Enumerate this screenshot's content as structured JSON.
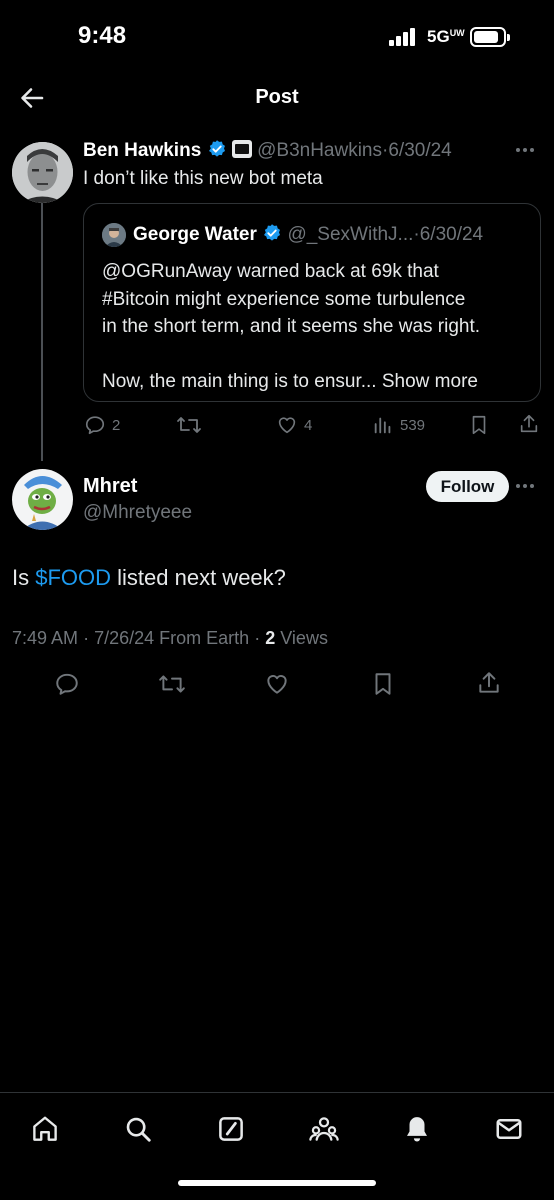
{
  "status_bar": {
    "time": "9:48",
    "network": "5G",
    "network_suffix": "UW"
  },
  "header": {
    "title": "Post"
  },
  "parent_post": {
    "name": "Ben Hawkins",
    "handle": "@B3nHawkins",
    "separator": "·",
    "date": "6/30/24",
    "text": "I don’t like this new bot meta",
    "more_icon": "ellipsis-icon",
    "quote": {
      "name": "George Water",
      "handle": "@_SexWithJ...",
      "separator": "·",
      "date": "6/30/24",
      "lines": [
        "@OGRunAway warned back at 69k that",
        "#Bitcoin  might experience some turbulence",
        "in the short term, and it seems she was right.",
        "",
        "Now, the main thing is to ensur..."
      ],
      "show_more": "Show more"
    },
    "actions": {
      "replies": "2",
      "reposts": "",
      "likes": "4",
      "views": "539"
    }
  },
  "main_post": {
    "name": "Mhret",
    "handle": "@Mhretyeee",
    "follow_label": "Follow",
    "text_before": "Is ",
    "cashtag": "$FOOD",
    "text_after": " listed next week?",
    "meta": {
      "time": "7:49 AM",
      "separator": "·",
      "date": "7/26/24",
      "source": "From Earth",
      "views_count": "2",
      "views_label": "Views"
    }
  },
  "colors": {
    "background": "#000000",
    "accent": "#1d9bf0",
    "muted": "#71767b",
    "border": "#2f3336"
  },
  "bottom_nav": {
    "items": [
      "home-icon",
      "search-icon",
      "grok-icon",
      "communities-icon",
      "notifications-icon",
      "messages-icon"
    ]
  }
}
